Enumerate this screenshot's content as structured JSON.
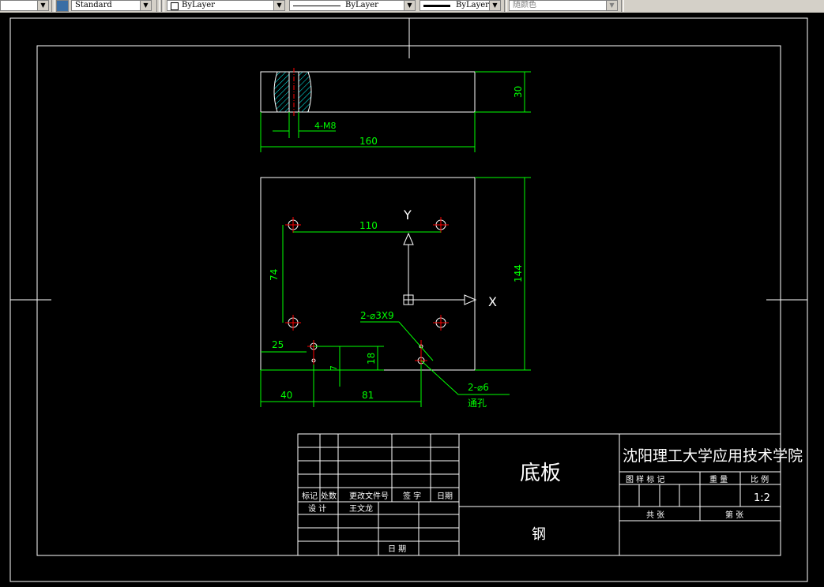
{
  "toolbar": {
    "text_style": "Standard",
    "layer": "ByLayer",
    "linetype": "ByLayer",
    "lineweight": "ByLayer",
    "color": "随颜色"
  },
  "drawing": {
    "colors": {
      "background": "#000000",
      "geometry": "#ffffff",
      "dimension": "#00ff00",
      "center": "#ff0000",
      "hatch": "#00ffff"
    },
    "dims_top": {
      "thickness": "30",
      "thread": "4-M8",
      "length": "160"
    },
    "dims_plan": {
      "hole_spacing_x": "110",
      "hole_spacing_y": "74",
      "height": "144",
      "offset_25": "25",
      "offset_7": "7",
      "offset_18": "18",
      "offset_40": "40",
      "offset_81": "81",
      "callout_pin": "2-⌀3X9",
      "callout_hole": "2-⌀6",
      "callout_through": "通孔"
    },
    "axes": {
      "x": "X",
      "y": "Y"
    }
  },
  "title_block": {
    "part_name": "底板",
    "material": "钢",
    "school": "沈阳理工大学应用技术学院",
    "hdr_mark": "标记",
    "hdr_count": "处数",
    "hdr_change": "更改文件号",
    "hdr_sign": "签 字",
    "hdr_date": "日期",
    "design_label": "设  计",
    "designer": "王文龙",
    "date_label": "日  期",
    "stage_mark": "图 样 标 记",
    "weight": "重  量",
    "scale_label": "比  例",
    "scale": "1:2",
    "total_sheets": "共      张",
    "sheet_no": "第      张"
  }
}
